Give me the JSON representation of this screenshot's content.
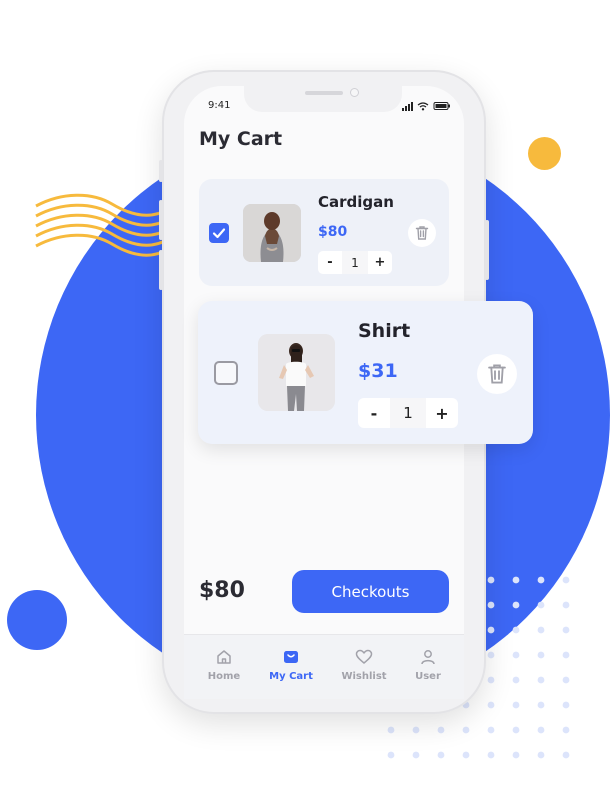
{
  "status_bar": {
    "time": "9:41"
  },
  "page_title": "My Cart",
  "cart_items": [
    {
      "name": "Cardigan",
      "price": "$80",
      "quantity": "1",
      "checked": true
    },
    {
      "name": "Shirt",
      "price": "$31",
      "quantity": "1",
      "checked": false
    }
  ],
  "stepper": {
    "minus": "-",
    "plus": "+"
  },
  "footer": {
    "total": "$80",
    "checkout_label": "Checkouts"
  },
  "tabs": [
    {
      "label": "Home",
      "icon": "home-icon",
      "active": false
    },
    {
      "label": "My Cart",
      "icon": "cart-bag-icon",
      "active": true
    },
    {
      "label": "Wishlist",
      "icon": "heart-icon",
      "active": false
    },
    {
      "label": "User",
      "icon": "user-icon",
      "active": false
    }
  ],
  "colors": {
    "accent": "#3d67f5",
    "decor_yellow": "#f7ba3d",
    "card_bg": "#eef1f8"
  }
}
